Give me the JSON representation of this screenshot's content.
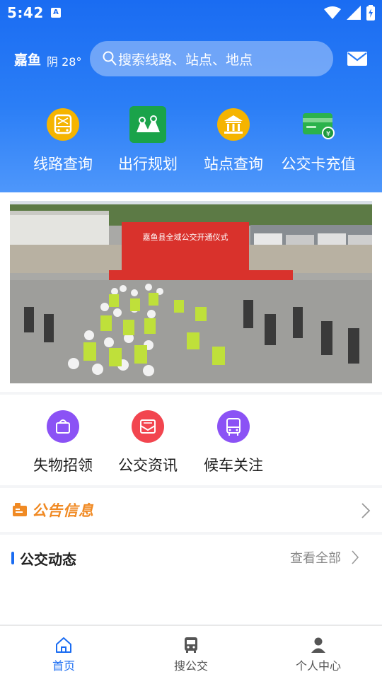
{
  "status": {
    "time": "5:42",
    "indicator": "A"
  },
  "header": {
    "city": "嘉鱼",
    "weather": "阴 28°",
    "search": {
      "placeholder": "搜索线路、站点、地点"
    }
  },
  "quick_actions": [
    {
      "label": "线路查询",
      "icon": "bus-route-icon",
      "color": "#f5b400"
    },
    {
      "label": "出行规划",
      "icon": "map-route-icon",
      "color": "#1aa34a"
    },
    {
      "label": "站点查询",
      "icon": "station-icon",
      "color": "#f5b400"
    },
    {
      "label": "公交卡充值",
      "icon": "card-recharge-icon",
      "color": "#2bb24c"
    }
  ],
  "banner": {
    "sign_text": "嘉鱼县全域公交开通仪式"
  },
  "services": [
    {
      "label": "失物招领",
      "icon": "lost-found-icon",
      "color": "#8b52f5"
    },
    {
      "label": "公交资讯",
      "icon": "news-mail-icon",
      "color": "#f2454f"
    },
    {
      "label": "候车关注",
      "icon": "bus-follow-icon",
      "color": "#8b52f5"
    }
  ],
  "notice": {
    "title": "公告信息"
  },
  "news": {
    "title": "公交动态",
    "more": "查看全部"
  },
  "tabbar": [
    {
      "label": "首页",
      "icon": "home-icon",
      "active": true
    },
    {
      "label": "搜公交",
      "icon": "bus-icon",
      "active": false
    },
    {
      "label": "个人中心",
      "icon": "profile-icon",
      "active": false
    }
  ],
  "colors": {
    "primary": "#1a6cf2",
    "accent": "#f08a24"
  }
}
